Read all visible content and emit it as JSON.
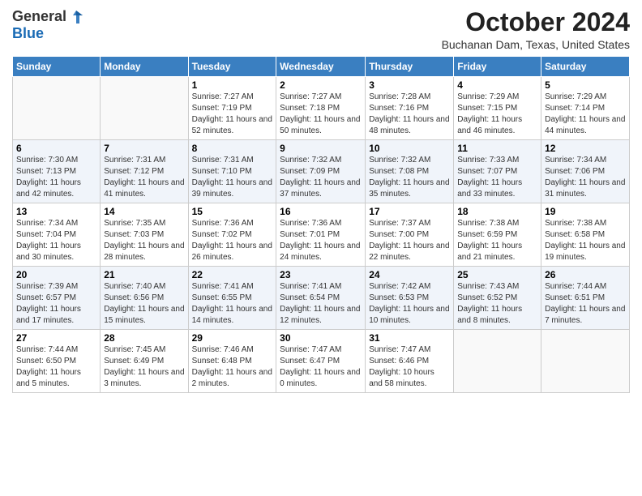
{
  "header": {
    "logo_line1": "General",
    "logo_line2": "Blue",
    "month_title": "October 2024",
    "location": "Buchanan Dam, Texas, United States"
  },
  "days_of_week": [
    "Sunday",
    "Monday",
    "Tuesday",
    "Wednesday",
    "Thursday",
    "Friday",
    "Saturday"
  ],
  "weeks": [
    [
      {
        "day": "",
        "sunrise": "",
        "sunset": "",
        "daylight": ""
      },
      {
        "day": "",
        "sunrise": "",
        "sunset": "",
        "daylight": ""
      },
      {
        "day": "1",
        "sunrise": "Sunrise: 7:27 AM",
        "sunset": "Sunset: 7:19 PM",
        "daylight": "Daylight: 11 hours and 52 minutes."
      },
      {
        "day": "2",
        "sunrise": "Sunrise: 7:27 AM",
        "sunset": "Sunset: 7:18 PM",
        "daylight": "Daylight: 11 hours and 50 minutes."
      },
      {
        "day": "3",
        "sunrise": "Sunrise: 7:28 AM",
        "sunset": "Sunset: 7:16 PM",
        "daylight": "Daylight: 11 hours and 48 minutes."
      },
      {
        "day": "4",
        "sunrise": "Sunrise: 7:29 AM",
        "sunset": "Sunset: 7:15 PM",
        "daylight": "Daylight: 11 hours and 46 minutes."
      },
      {
        "day": "5",
        "sunrise": "Sunrise: 7:29 AM",
        "sunset": "Sunset: 7:14 PM",
        "daylight": "Daylight: 11 hours and 44 minutes."
      }
    ],
    [
      {
        "day": "6",
        "sunrise": "Sunrise: 7:30 AM",
        "sunset": "Sunset: 7:13 PM",
        "daylight": "Daylight: 11 hours and 42 minutes."
      },
      {
        "day": "7",
        "sunrise": "Sunrise: 7:31 AM",
        "sunset": "Sunset: 7:12 PM",
        "daylight": "Daylight: 11 hours and 41 minutes."
      },
      {
        "day": "8",
        "sunrise": "Sunrise: 7:31 AM",
        "sunset": "Sunset: 7:10 PM",
        "daylight": "Daylight: 11 hours and 39 minutes."
      },
      {
        "day": "9",
        "sunrise": "Sunrise: 7:32 AM",
        "sunset": "Sunset: 7:09 PM",
        "daylight": "Daylight: 11 hours and 37 minutes."
      },
      {
        "day": "10",
        "sunrise": "Sunrise: 7:32 AM",
        "sunset": "Sunset: 7:08 PM",
        "daylight": "Daylight: 11 hours and 35 minutes."
      },
      {
        "day": "11",
        "sunrise": "Sunrise: 7:33 AM",
        "sunset": "Sunset: 7:07 PM",
        "daylight": "Daylight: 11 hours and 33 minutes."
      },
      {
        "day": "12",
        "sunrise": "Sunrise: 7:34 AM",
        "sunset": "Sunset: 7:06 PM",
        "daylight": "Daylight: 11 hours and 31 minutes."
      }
    ],
    [
      {
        "day": "13",
        "sunrise": "Sunrise: 7:34 AM",
        "sunset": "Sunset: 7:04 PM",
        "daylight": "Daylight: 11 hours and 30 minutes."
      },
      {
        "day": "14",
        "sunrise": "Sunrise: 7:35 AM",
        "sunset": "Sunset: 7:03 PM",
        "daylight": "Daylight: 11 hours and 28 minutes."
      },
      {
        "day": "15",
        "sunrise": "Sunrise: 7:36 AM",
        "sunset": "Sunset: 7:02 PM",
        "daylight": "Daylight: 11 hours and 26 minutes."
      },
      {
        "day": "16",
        "sunrise": "Sunrise: 7:36 AM",
        "sunset": "Sunset: 7:01 PM",
        "daylight": "Daylight: 11 hours and 24 minutes."
      },
      {
        "day": "17",
        "sunrise": "Sunrise: 7:37 AM",
        "sunset": "Sunset: 7:00 PM",
        "daylight": "Daylight: 11 hours and 22 minutes."
      },
      {
        "day": "18",
        "sunrise": "Sunrise: 7:38 AM",
        "sunset": "Sunset: 6:59 PM",
        "daylight": "Daylight: 11 hours and 21 minutes."
      },
      {
        "day": "19",
        "sunrise": "Sunrise: 7:38 AM",
        "sunset": "Sunset: 6:58 PM",
        "daylight": "Daylight: 11 hours and 19 minutes."
      }
    ],
    [
      {
        "day": "20",
        "sunrise": "Sunrise: 7:39 AM",
        "sunset": "Sunset: 6:57 PM",
        "daylight": "Daylight: 11 hours and 17 minutes."
      },
      {
        "day": "21",
        "sunrise": "Sunrise: 7:40 AM",
        "sunset": "Sunset: 6:56 PM",
        "daylight": "Daylight: 11 hours and 15 minutes."
      },
      {
        "day": "22",
        "sunrise": "Sunrise: 7:41 AM",
        "sunset": "Sunset: 6:55 PM",
        "daylight": "Daylight: 11 hours and 14 minutes."
      },
      {
        "day": "23",
        "sunrise": "Sunrise: 7:41 AM",
        "sunset": "Sunset: 6:54 PM",
        "daylight": "Daylight: 11 hours and 12 minutes."
      },
      {
        "day": "24",
        "sunrise": "Sunrise: 7:42 AM",
        "sunset": "Sunset: 6:53 PM",
        "daylight": "Daylight: 11 hours and 10 minutes."
      },
      {
        "day": "25",
        "sunrise": "Sunrise: 7:43 AM",
        "sunset": "Sunset: 6:52 PM",
        "daylight": "Daylight: 11 hours and 8 minutes."
      },
      {
        "day": "26",
        "sunrise": "Sunrise: 7:44 AM",
        "sunset": "Sunset: 6:51 PM",
        "daylight": "Daylight: 11 hours and 7 minutes."
      }
    ],
    [
      {
        "day": "27",
        "sunrise": "Sunrise: 7:44 AM",
        "sunset": "Sunset: 6:50 PM",
        "daylight": "Daylight: 11 hours and 5 minutes."
      },
      {
        "day": "28",
        "sunrise": "Sunrise: 7:45 AM",
        "sunset": "Sunset: 6:49 PM",
        "daylight": "Daylight: 11 hours and 3 minutes."
      },
      {
        "day": "29",
        "sunrise": "Sunrise: 7:46 AM",
        "sunset": "Sunset: 6:48 PM",
        "daylight": "Daylight: 11 hours and 2 minutes."
      },
      {
        "day": "30",
        "sunrise": "Sunrise: 7:47 AM",
        "sunset": "Sunset: 6:47 PM",
        "daylight": "Daylight: 11 hours and 0 minutes."
      },
      {
        "day": "31",
        "sunrise": "Sunrise: 7:47 AM",
        "sunset": "Sunset: 6:46 PM",
        "daylight": "Daylight: 10 hours and 58 minutes."
      },
      {
        "day": "",
        "sunrise": "",
        "sunset": "",
        "daylight": ""
      },
      {
        "day": "",
        "sunrise": "",
        "sunset": "",
        "daylight": ""
      }
    ]
  ]
}
